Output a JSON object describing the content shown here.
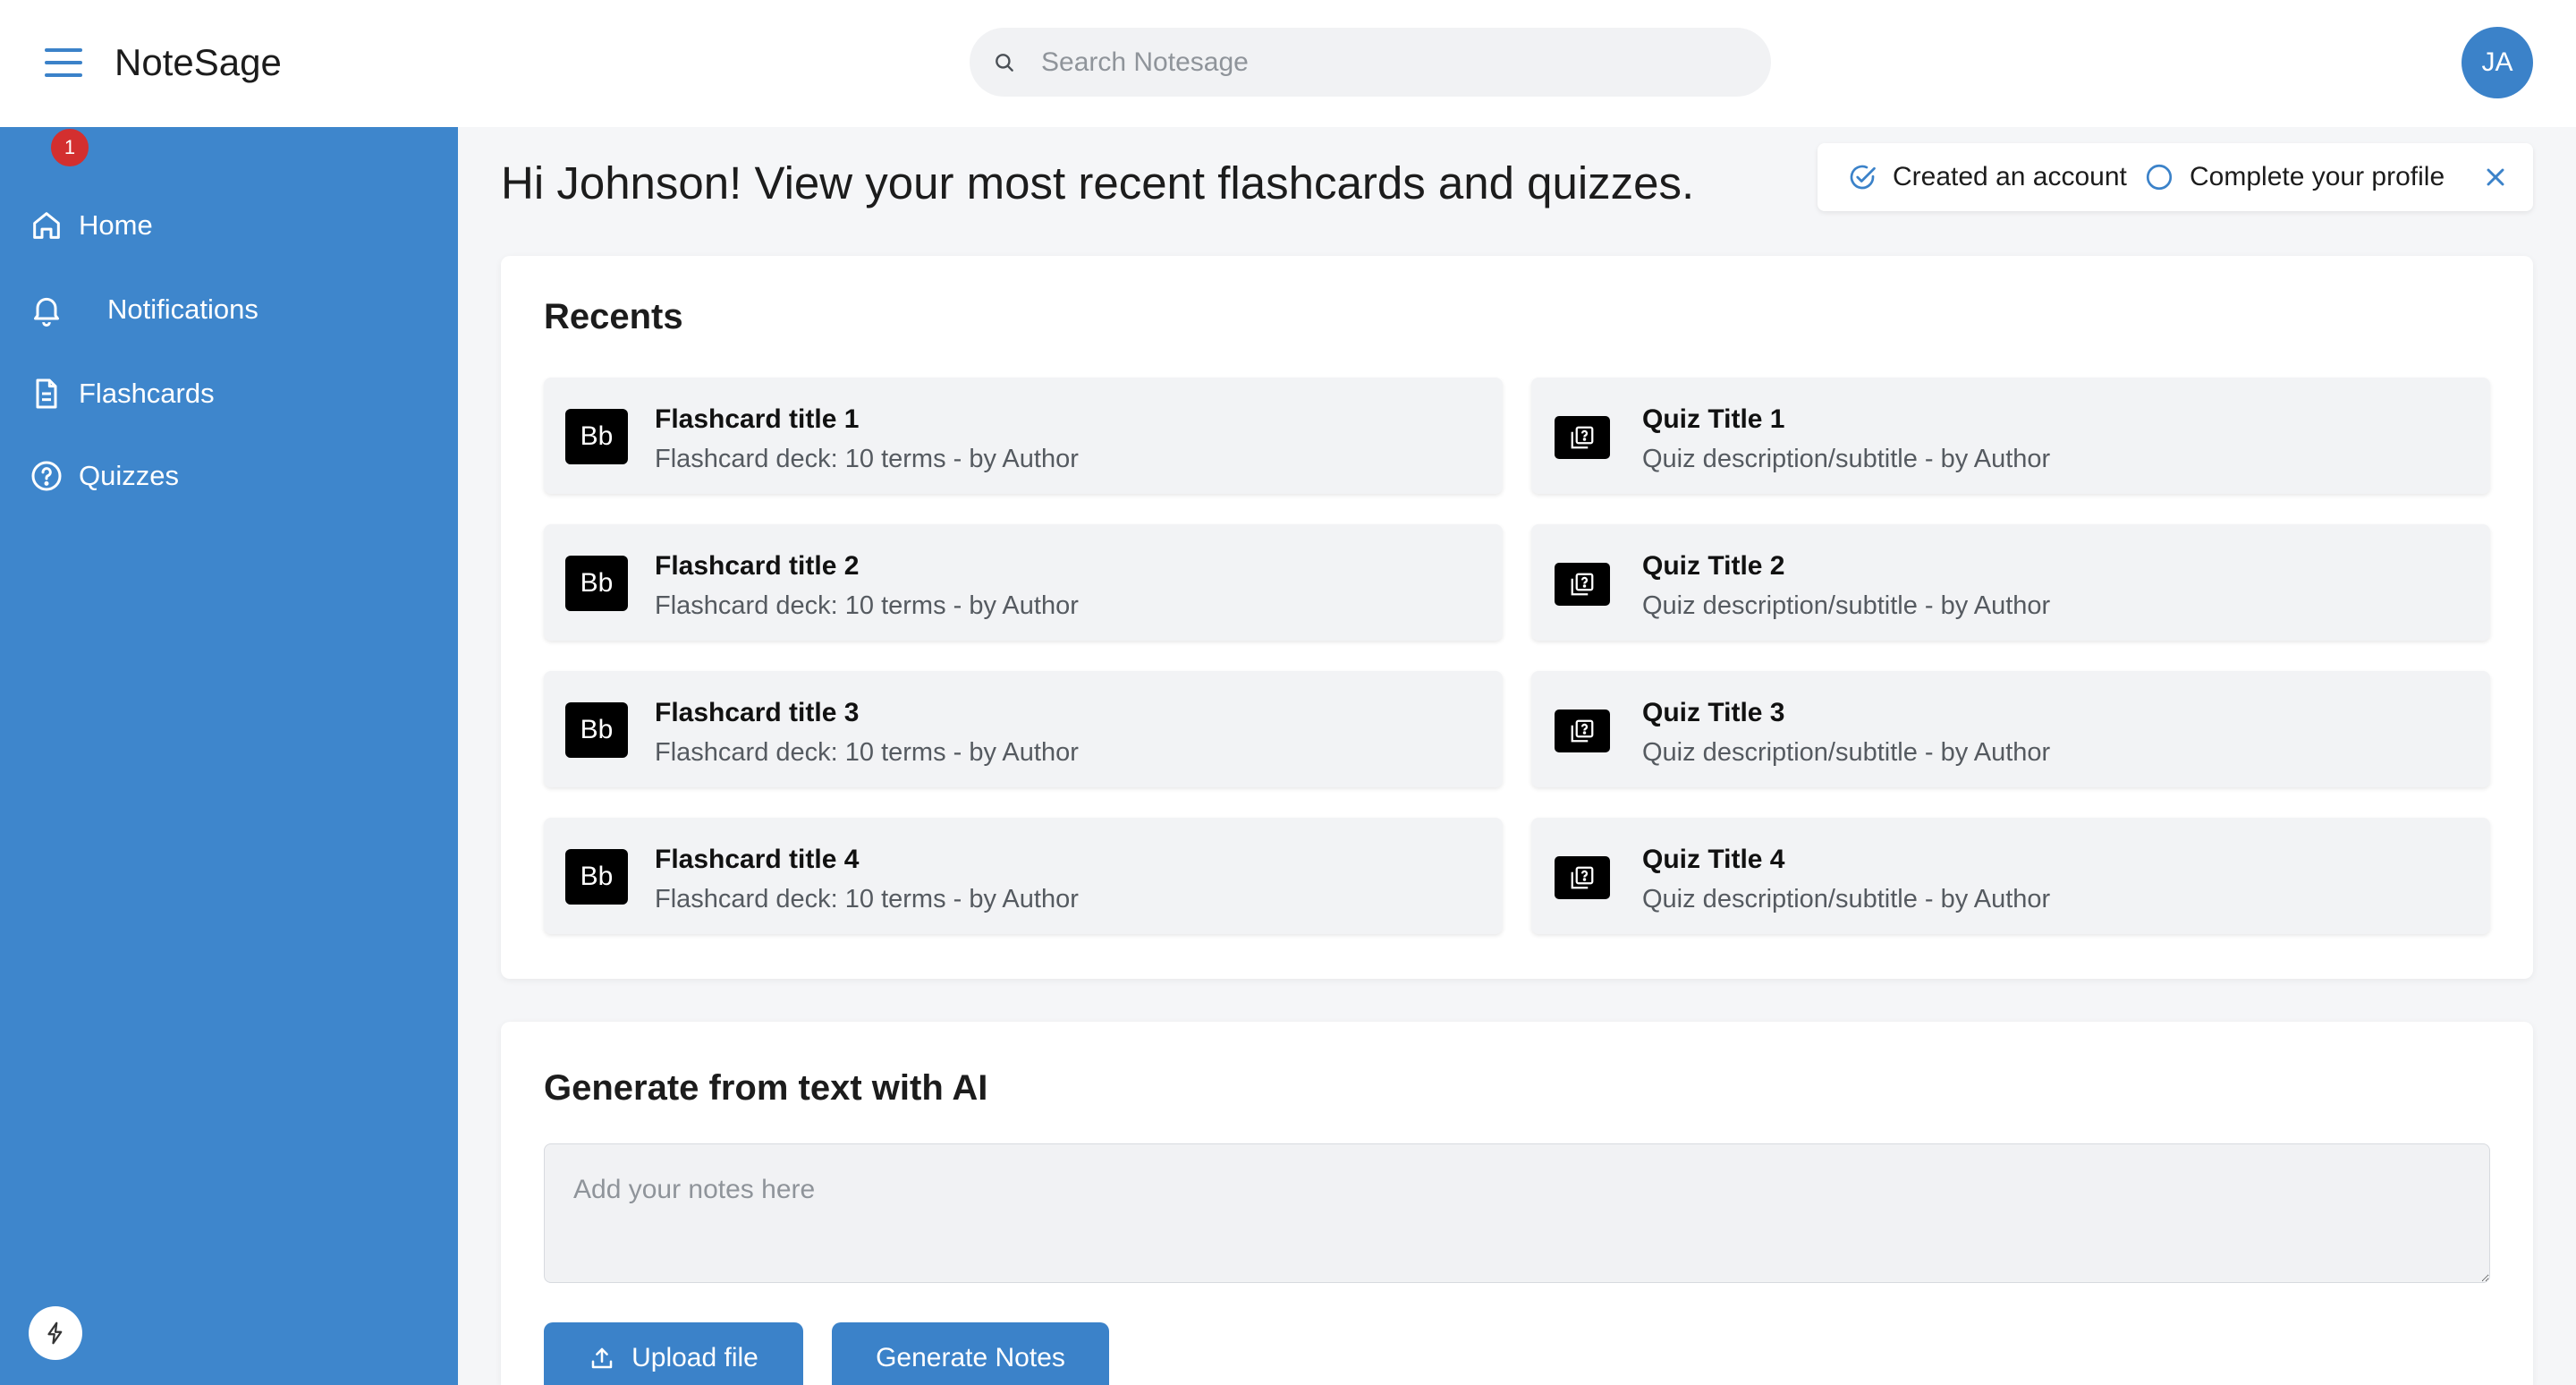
{
  "app": {
    "title": "NoteSage",
    "user_initials": "JA"
  },
  "search": {
    "placeholder": "Search Notesage"
  },
  "sidebar": {
    "items": [
      {
        "label": "Home",
        "icon": "home-icon"
      },
      {
        "label": "Notifications",
        "icon": "bell-icon",
        "badge": "1"
      },
      {
        "label": "Flashcards",
        "icon": "document-icon"
      },
      {
        "label": "Quizzes",
        "icon": "question-circle-icon"
      }
    ],
    "bottom_icon": "bolt-icon"
  },
  "main": {
    "greeting": "Hi Johnson! View your most recent flashcards and quizzes.",
    "checklist": {
      "items": [
        {
          "label": "Created an account",
          "done": true
        },
        {
          "label": "Complete your profile",
          "done": false
        }
      ]
    },
    "recents": {
      "title": "Recents",
      "flashcards": [
        {
          "icon_text": "Bb",
          "title": "Flashcard title 1",
          "subtitle": "Flashcard deck: 10 terms - by Author"
        },
        {
          "icon_text": "Bb",
          "title": "Flashcard title 2",
          "subtitle": "Flashcard deck: 10 terms - by Author"
        },
        {
          "icon_text": "Bb",
          "title": "Flashcard title 3",
          "subtitle": "Flashcard deck: 10 terms - by Author"
        },
        {
          "icon_text": "Bb",
          "title": "Flashcard title 4",
          "subtitle": "Flashcard deck: 10 terms - by Author"
        }
      ],
      "quizzes": [
        {
          "title": "Quiz Title 1",
          "subtitle": "Quiz description/subtitle - by Author"
        },
        {
          "title": "Quiz Title 2",
          "subtitle": "Quiz description/subtitle - by Author"
        },
        {
          "title": "Quiz Title 3",
          "subtitle": "Quiz description/subtitle - by Author"
        },
        {
          "title": "Quiz Title 4",
          "subtitle": "Quiz description/subtitle - by Author"
        }
      ]
    },
    "generate": {
      "title": "Generate from text with AI",
      "placeholder": "Add your notes here",
      "upload_label": "Upload file",
      "generate_label": "Generate Notes"
    }
  },
  "colors": {
    "accent": "#3b82c9",
    "sidebar": "#3e86cc",
    "badge": "#d32f2f"
  }
}
